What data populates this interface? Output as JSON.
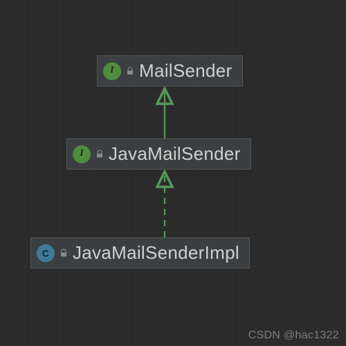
{
  "diagram": {
    "nodes": {
      "mailsender": {
        "label": "MailSender",
        "kind_letter": "I",
        "kind": "interface",
        "locked": true
      },
      "javamailsender": {
        "label": "JavaMailSender",
        "kind_letter": "I",
        "kind": "interface",
        "locked": true
      },
      "javamailsenderimpl": {
        "label": "JavaMailSenderImpl",
        "kind_letter": "C",
        "kind": "class",
        "locked": true
      }
    },
    "edges": [
      {
        "from": "javamailsender",
        "to": "mailsender",
        "style": "solid",
        "relation": "extends"
      },
      {
        "from": "javamailsenderimpl",
        "to": "javamailsender",
        "style": "dashed",
        "relation": "implements"
      }
    ],
    "colors": {
      "background": "#2b2b2b",
      "node_fill": "#3b3f41",
      "node_border": "#555657",
      "text": "#d0d0d0",
      "interface_badge": "#4f8c3d",
      "class_badge": "#3f7a99",
      "arrow": "#59965c"
    }
  },
  "watermark": "CSDN @hac1322",
  "chart_data": {
    "type": "diagram",
    "title": "",
    "nodes": [
      {
        "id": "MailSender",
        "stereotype": "interface"
      },
      {
        "id": "JavaMailSender",
        "stereotype": "interface"
      },
      {
        "id": "JavaMailSenderImpl",
        "stereotype": "class"
      }
    ],
    "edges": [
      {
        "from": "JavaMailSender",
        "to": "MailSender",
        "relation": "extends",
        "line": "solid"
      },
      {
        "from": "JavaMailSenderImpl",
        "to": "JavaMailSender",
        "relation": "implements",
        "line": "dashed"
      }
    ]
  }
}
